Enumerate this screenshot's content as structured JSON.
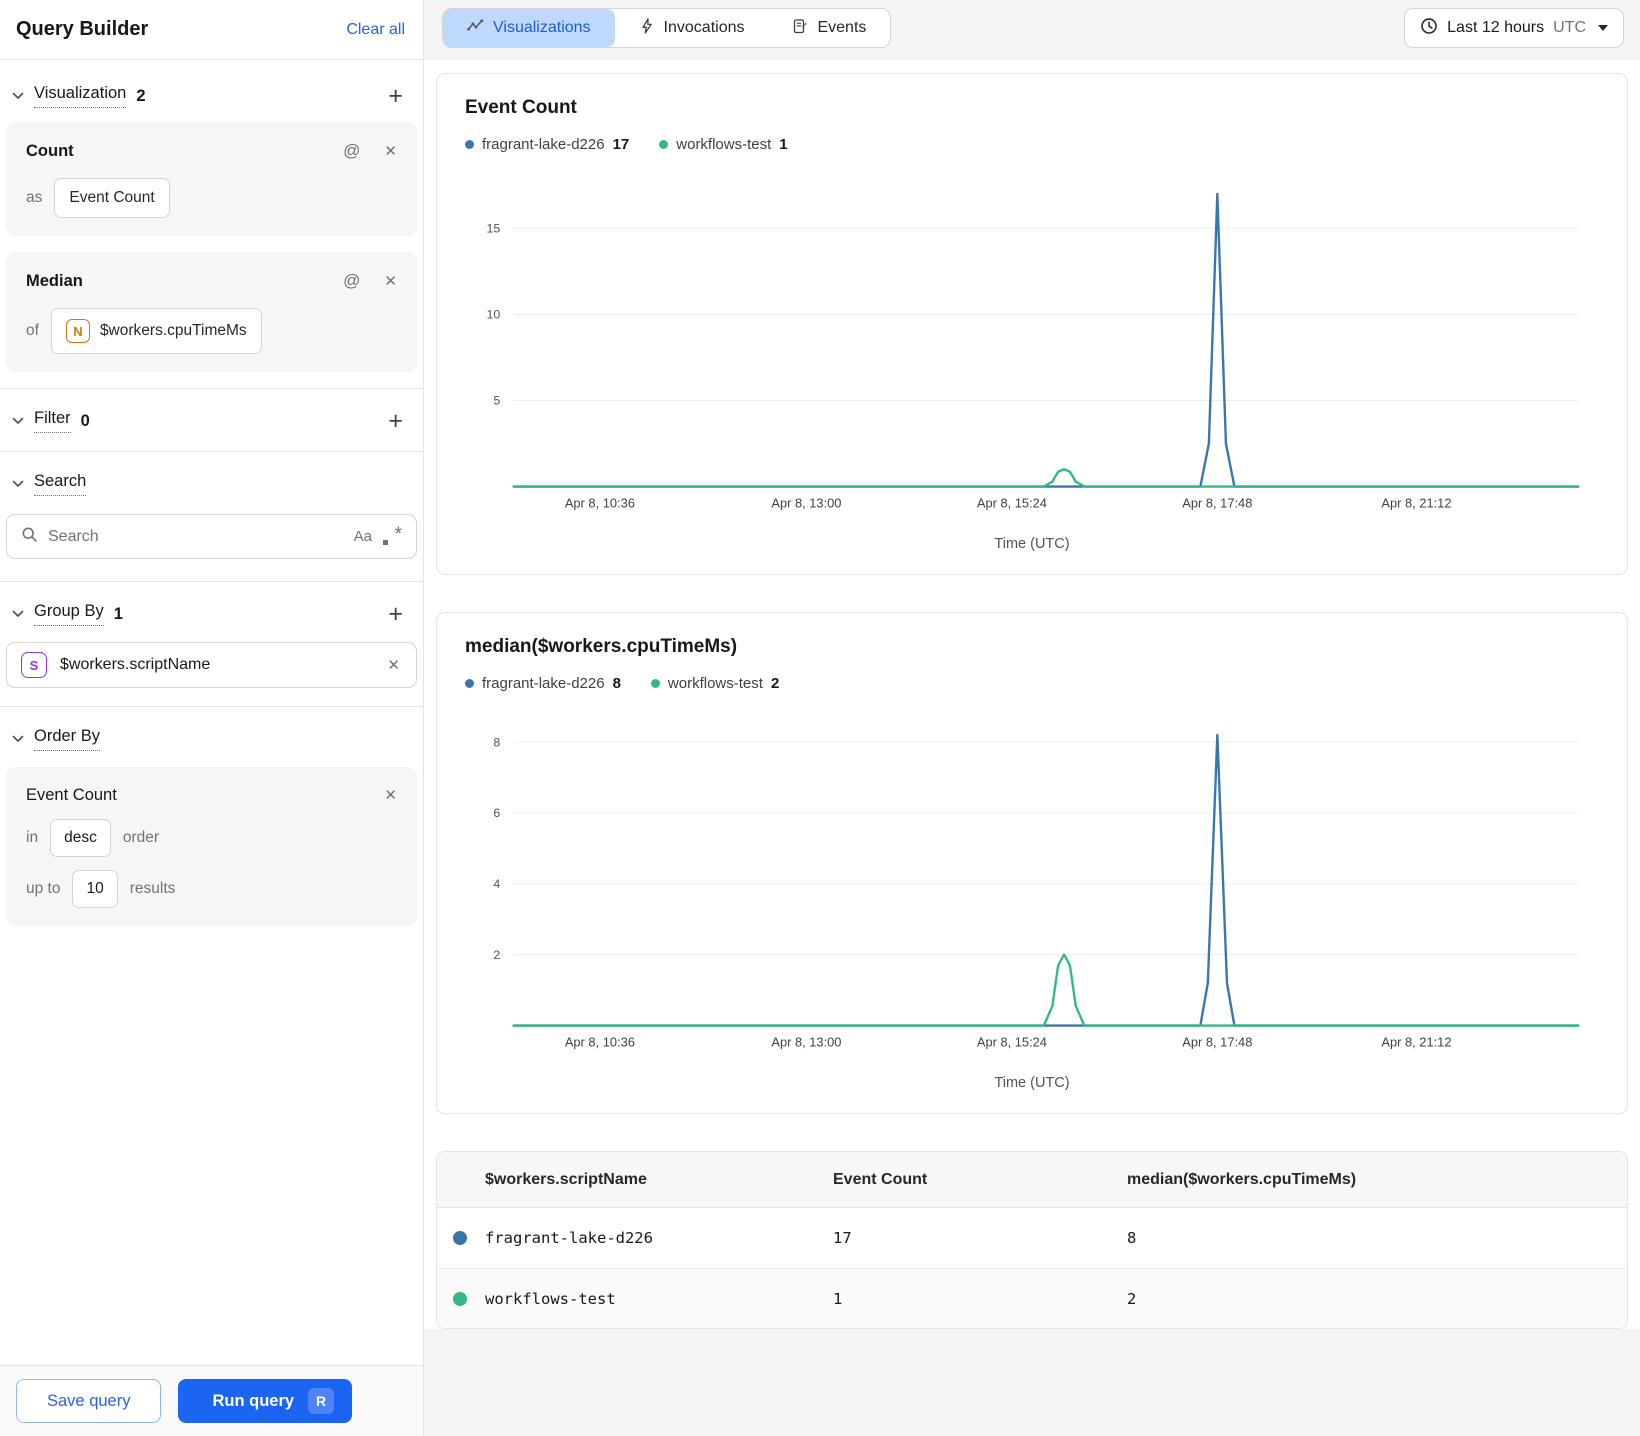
{
  "colors": {
    "accent_blue": "#1c64f2",
    "link_blue": "#2563eb",
    "tab_active_bg": "#bed9fb",
    "tab_active_text": "#1d5bd8",
    "series_blue": "#3b76aa",
    "series_green": "#35b884",
    "number_field_orange": "#cf7911",
    "string_field_purple": "#9333ea"
  },
  "icons": {
    "at": "@",
    "close": "✕",
    "add": "+",
    "match_case": "Aa",
    "regex_asterisk": "*"
  },
  "sidebar": {
    "title": "Query Builder",
    "clear_all": "Clear all",
    "visualization": {
      "label": "Visualization",
      "count": "2"
    },
    "count_card": {
      "title": "Count",
      "as_label": "as",
      "value": "Event Count"
    },
    "median_card": {
      "title": "Median",
      "of_label": "of",
      "field_badge": "N",
      "value": "$workers.cpuTimeMs"
    },
    "filter": {
      "label": "Filter",
      "count": "0"
    },
    "search": {
      "label": "Search",
      "placeholder": "Search"
    },
    "group_by": {
      "label": "Group By",
      "count": "1",
      "item": {
        "field_badge": "S",
        "value": "$workers.scriptName"
      }
    },
    "order_by": {
      "label": "Order By",
      "item": {
        "title": "Event Count",
        "in_label": "in",
        "direction": "desc",
        "order_label": "order",
        "up_to_label": "up to",
        "limit": "10",
        "results_label": "results"
      }
    },
    "footer": {
      "save": "Save query",
      "run": "Run query",
      "run_shortcut": "R"
    }
  },
  "header": {
    "tabs": [
      {
        "label": "Visualizations",
        "icon": "line-chart-icon",
        "active": true
      },
      {
        "label": "Invocations",
        "icon": "lightning-icon",
        "active": false
      },
      {
        "label": "Events",
        "icon": "events-icon",
        "active": false
      }
    ],
    "time_range": {
      "label": "Last 12 hours",
      "zone": "UTC"
    }
  },
  "chart_data": [
    {
      "type": "line",
      "title": "Event Count",
      "xlabel": "Time (UTC)",
      "legend": [
        {
          "name": "fragrant-lake-d226",
          "total": "17",
          "color": "#3b76aa"
        },
        {
          "name": "workflows-test",
          "total": "1",
          "color": "#35b884"
        }
      ],
      "x_ticks": [
        "Apr 8, 10:36",
        "Apr 8, 13:00",
        "Apr 8, 15:24",
        "Apr 8, 17:48",
        "Apr 8, 21:12"
      ],
      "x_tick_pos": [
        0.081,
        0.275,
        0.468,
        0.661,
        0.848
      ],
      "y_ticks": [
        5,
        10,
        15
      ],
      "ylim": [
        0,
        17.5
      ],
      "grid": true,
      "legend_position": "top",
      "series": [
        {
          "name": "fragrant-lake-d226",
          "color": "#3b76aa",
          "points": [
            [
              0,
              0
            ],
            [
              0.645,
              0
            ],
            [
              0.653,
              2.5
            ],
            [
              0.661,
              17
            ],
            [
              0.669,
              2.5
            ],
            [
              0.677,
              0
            ],
            [
              1,
              0
            ]
          ]
        },
        {
          "name": "workflows-test",
          "color": "#35b884",
          "points": [
            [
              0,
              0
            ],
            [
              0.498,
              0
            ],
            [
              0.506,
              0.28
            ],
            [
              0.5115,
              0.86
            ],
            [
              0.517,
              1
            ],
            [
              0.5225,
              0.86
            ],
            [
              0.528,
              0.28
            ],
            [
              0.536,
              0
            ],
            [
              1,
              0
            ]
          ]
        }
      ]
    },
    {
      "type": "line",
      "title": "median($workers.cpuTimeMs)",
      "xlabel": "Time (UTC)",
      "legend": [
        {
          "name": "fragrant-lake-d226",
          "total": "8",
          "color": "#3b76aa"
        },
        {
          "name": "workflows-test",
          "total": "2",
          "color": "#35b884"
        }
      ],
      "x_ticks": [
        "Apr 8, 10:36",
        "Apr 8, 13:00",
        "Apr 8, 15:24",
        "Apr 8, 17:48",
        "Apr 8, 21:12"
      ],
      "x_tick_pos": [
        0.081,
        0.275,
        0.468,
        0.661,
        0.848
      ],
      "y_ticks": [
        2,
        4,
        6,
        8
      ],
      "ylim": [
        0,
        8.5
      ],
      "grid": true,
      "legend_position": "top",
      "series": [
        {
          "name": "fragrant-lake-d226",
          "color": "#3b76aa",
          "points": [
            [
              0,
              0
            ],
            [
              0.645,
              0
            ],
            [
              0.652,
              1.2
            ],
            [
              0.661,
              8.2
            ],
            [
              0.67,
              1.2
            ],
            [
              0.677,
              0
            ],
            [
              1,
              0
            ]
          ]
        },
        {
          "name": "workflows-test",
          "color": "#35b884",
          "points": [
            [
              0,
              0
            ],
            [
              0.498,
              0
            ],
            [
              0.506,
              0.55
            ],
            [
              0.5115,
              1.7
            ],
            [
              0.517,
              2
            ],
            [
              0.5225,
              1.7
            ],
            [
              0.528,
              0.55
            ],
            [
              0.536,
              0
            ],
            [
              1,
              0
            ]
          ]
        }
      ]
    }
  ],
  "table": {
    "columns": [
      "$workers.scriptName",
      "Event Count",
      "median($workers.cpuTimeMs)"
    ],
    "rows": [
      {
        "color": "#3b76aa",
        "name": "fragrant-lake-d226",
        "event_count": "17",
        "median": "8"
      },
      {
        "color": "#35b884",
        "name": "workflows-test",
        "event_count": "1",
        "median": "2"
      }
    ]
  }
}
